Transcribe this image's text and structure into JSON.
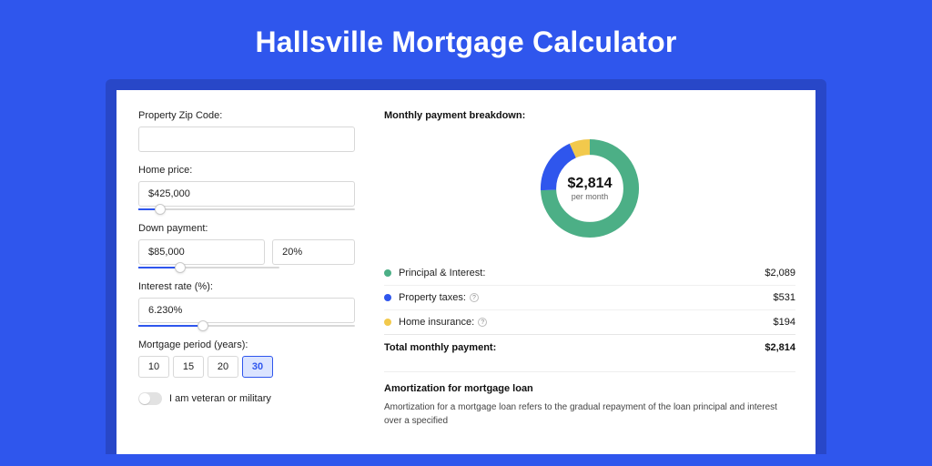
{
  "title": "Hallsville Mortgage Calculator",
  "form": {
    "zip_label": "Property Zip Code:",
    "zip_value": "",
    "home_price_label": "Home price:",
    "home_price_value": "$425,000",
    "home_price_slider_pct": 10,
    "down_payment_label": "Down payment:",
    "down_payment_value": "$85,000",
    "down_payment_pct": "20%",
    "down_payment_slider_pct": 20,
    "interest_label": "Interest rate (%):",
    "interest_value": "6.230%",
    "interest_slider_pct": 30,
    "period_label": "Mortgage period (years):",
    "periods": [
      "10",
      "15",
      "20",
      "30"
    ],
    "period_selected": "30",
    "veteran_label": "I am veteran or military"
  },
  "breakdown": {
    "title": "Monthly payment breakdown:",
    "center_amount": "$2,814",
    "center_sub": "per month",
    "items": [
      {
        "label": "Principal & Interest:",
        "value": "$2,089",
        "color": "#4caf86",
        "help": false
      },
      {
        "label": "Property taxes:",
        "value": "$531",
        "color": "#2f56ed",
        "help": true
      },
      {
        "label": "Home insurance:",
        "value": "$194",
        "color": "#f2c94c",
        "help": true
      }
    ],
    "total_label": "Total monthly payment:",
    "total_value": "$2,814"
  },
  "amort": {
    "title": "Amortization for mortgage loan",
    "body": "Amortization for a mortgage loan refers to the gradual repayment of the loan principal and interest over a specified"
  },
  "chart_data": {
    "type": "pie",
    "title": "Monthly payment breakdown",
    "series": [
      {
        "name": "Principal & Interest",
        "value": 2089,
        "color": "#4caf86"
      },
      {
        "name": "Property taxes",
        "value": 531,
        "color": "#2f56ed"
      },
      {
        "name": "Home insurance",
        "value": 194,
        "color": "#f2c94c"
      }
    ],
    "total": 2814,
    "center_label": "$2,814 per month"
  }
}
